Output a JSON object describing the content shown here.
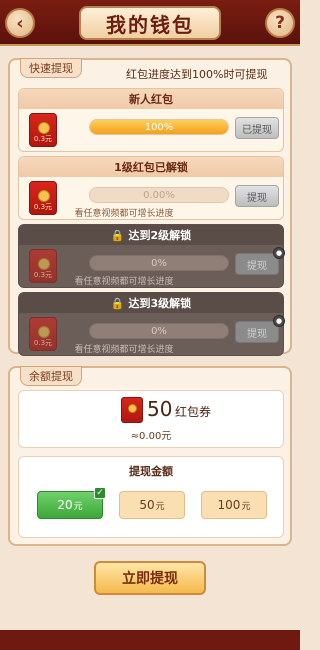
{
  "header": {
    "back_icon": "‹",
    "title": "我的钱包",
    "help_icon": "?"
  },
  "quick_withdraw": {
    "tag": "快速提现",
    "note": "红包进度达到100%时可提现",
    "levels": [
      {
        "title": "新人红包",
        "envelope_amount": "0.3元",
        "progress_text": "100%",
        "progress_fraction": 1.0,
        "button_label": "已提现",
        "hint": "",
        "locked": false
      },
      {
        "title": "1级红包已解锁",
        "envelope_amount": "0.3元",
        "progress_text": "0.00%",
        "progress_fraction": 0.0,
        "button_label": "提现",
        "hint": "看任意视频都可增长进度",
        "locked": false
      },
      {
        "title": "达到2级解锁",
        "envelope_amount": "0.3元",
        "progress_text": "0%",
        "progress_fraction": 0.0,
        "button_label": "提现",
        "hint": "看任意视频都可增长进度",
        "locked": true
      },
      {
        "title": "达到3级解锁",
        "envelope_amount": "0.3元",
        "progress_text": "0%",
        "progress_fraction": 0.0,
        "button_label": "提现",
        "hint": "看任意视频都可增长进度",
        "locked": true
      }
    ]
  },
  "balance": {
    "tag": "余额提现",
    "coupon_count": "50",
    "coupon_unit": "红包券",
    "equivalent": "≈0.00元"
  },
  "amount_select": {
    "title": "提现金额",
    "options": [
      {
        "value": "20",
        "unit": "元",
        "selected": true
      },
      {
        "value": "50",
        "unit": "元",
        "selected": false
      },
      {
        "value": "100",
        "unit": "元",
        "selected": false
      }
    ]
  },
  "submit_label": "立即提现",
  "colors": {
    "header_bg": "#7a1d12",
    "accent_orange": "#f2a11e",
    "selected_green": "#3ca73a",
    "locked_gray": "#6b5d58"
  }
}
